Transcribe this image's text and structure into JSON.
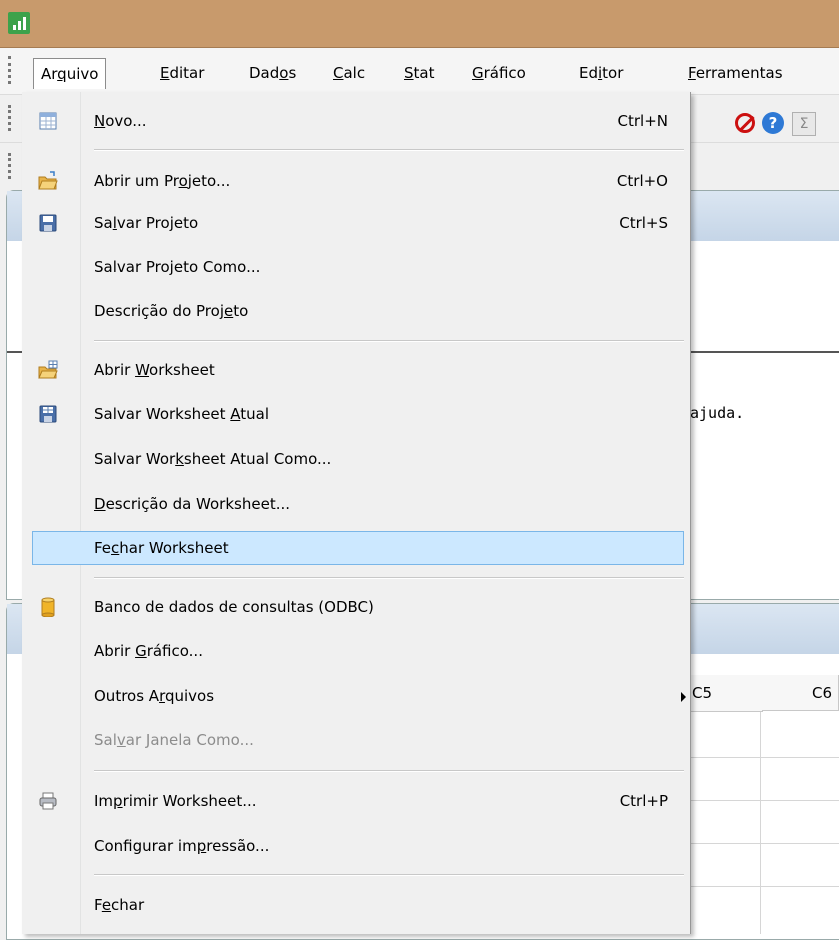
{
  "menubar": {
    "items": [
      {
        "pre": "Ar",
        "u": "q",
        "post": "uivo"
      },
      {
        "pre": "",
        "u": "E",
        "post": "ditar"
      },
      {
        "pre": "Dad",
        "u": "o",
        "post": "s"
      },
      {
        "pre": "",
        "u": "C",
        "post": "alc"
      },
      {
        "pre": "",
        "u": "S",
        "post": "tat"
      },
      {
        "pre": "",
        "u": "G",
        "post": "ráfico"
      },
      {
        "pre": "Ed",
        "u": "i",
        "post": "tor"
      },
      {
        "pre": "",
        "u": "F",
        "post": "erramentas"
      }
    ]
  },
  "session": {
    "fragment": "ajuda."
  },
  "worksheet": {
    "col5": "C5",
    "col6": "C6"
  },
  "toolbar": {
    "help_glyph": "?",
    "sum_glyph": "Σ"
  },
  "menu": {
    "items": [
      {
        "pre": "",
        "u": "N",
        "post": "ovo...",
        "shortcut": "Ctrl+N"
      },
      {
        "pre": "Abrir um Pr",
        "u": "o",
        "post": "jeto...",
        "shortcut": "Ctrl+O"
      },
      {
        "pre": "Sa",
        "u": "l",
        "post": "var Projeto",
        "shortcut": "Ctrl+S"
      },
      {
        "pre": "Salvar Projeto Como...",
        "u": "",
        "post": "",
        "shortcut": ""
      },
      {
        "pre": "Descrição do Proj",
        "u": "e",
        "post": "to",
        "shortcut": ""
      },
      {
        "pre": "Abrir ",
        "u": "W",
        "post": "orksheet",
        "shortcut": ""
      },
      {
        "pre": "Salvar Worksheet ",
        "u": "A",
        "post": "tual",
        "shortcut": ""
      },
      {
        "pre": "Salvar Wor",
        "u": "k",
        "post": "sheet Atual Como...",
        "shortcut": ""
      },
      {
        "pre": "",
        "u": "D",
        "post": "escrição da Worksheet...",
        "shortcut": ""
      },
      {
        "pre": "Fe",
        "u": "c",
        "post": "har Worksheet",
        "shortcut": ""
      },
      {
        "pre": "Banco de dados de consultas (ODBC)",
        "u": "",
        "post": "",
        "shortcut": ""
      },
      {
        "pre": "Abrir ",
        "u": "G",
        "post": "ráfico...",
        "shortcut": ""
      },
      {
        "pre": "Outros A",
        "u": "r",
        "post": "quivos",
        "shortcut": ""
      },
      {
        "pre": "Sal",
        "u": "v",
        "post": "ar Janela Como...",
        "shortcut": ""
      },
      {
        "pre": "Im",
        "u": "p",
        "post": "rimir Worksheet...",
        "shortcut": "Ctrl+P"
      },
      {
        "pre": "Configurar im",
        "u": "p",
        "post": "ressão...",
        "shortcut": ""
      },
      {
        "pre": "F",
        "u": "e",
        "post": "char",
        "shortcut": ""
      }
    ],
    "highlighted": "Fechar Worksheet",
    "disabled": "Salvar Janela Como..."
  }
}
